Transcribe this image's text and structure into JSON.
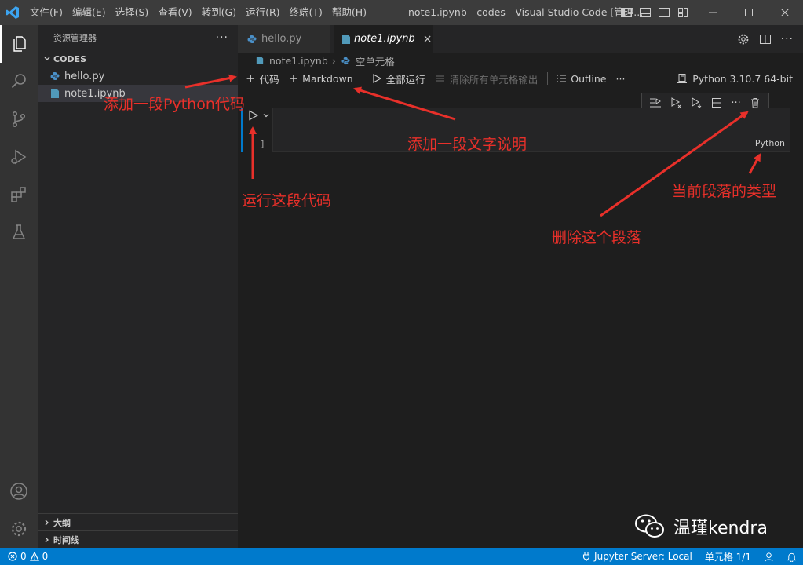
{
  "titlebar": {
    "menus": [
      "文件(F)",
      "编辑(E)",
      "选择(S)",
      "查看(V)",
      "转到(G)",
      "运行(R)",
      "终端(T)",
      "帮助(H)"
    ],
    "window_title": "note1.ipynb - codes - Visual Studio Code [管理..."
  },
  "sidebar": {
    "header": "资源管理器",
    "more": "···",
    "folder": "CODES",
    "files": [
      "hello.py",
      "note1.ipynb"
    ],
    "outline": "大纲",
    "timeline": "时间线"
  },
  "tabs": [
    {
      "label": "hello.py"
    },
    {
      "label": "note1.ipynb",
      "close": "×"
    }
  ],
  "breadcrumb": {
    "file": "note1.ipynb",
    "cell": "空单元格"
  },
  "notebook_toolbar": {
    "add_code": "代码",
    "add_markdown": "Markdown",
    "run_all": "全部运行",
    "clear_outputs": "清除所有单元格输出",
    "outline": "Outline",
    "more": "···",
    "kernel": "Python 3.10.7 64-bit"
  },
  "cell": {
    "bracket": "]",
    "language": "Python"
  },
  "annotations": {
    "add_python": "添加一段Python代码",
    "add_text": "添加一段文字说明",
    "run_code": "运行这段代码",
    "cell_type": "当前段落的类型",
    "delete_cell": "删除这个段落"
  },
  "watermark": "温瑾kendra",
  "statusbar": {
    "errors": "0",
    "warnings": "0",
    "jupyter": "Jupyter Server: Local",
    "cell_index": "单元格 1/1"
  },
  "colors": {
    "accent": "#007acc",
    "annotation": "#e8302a"
  }
}
